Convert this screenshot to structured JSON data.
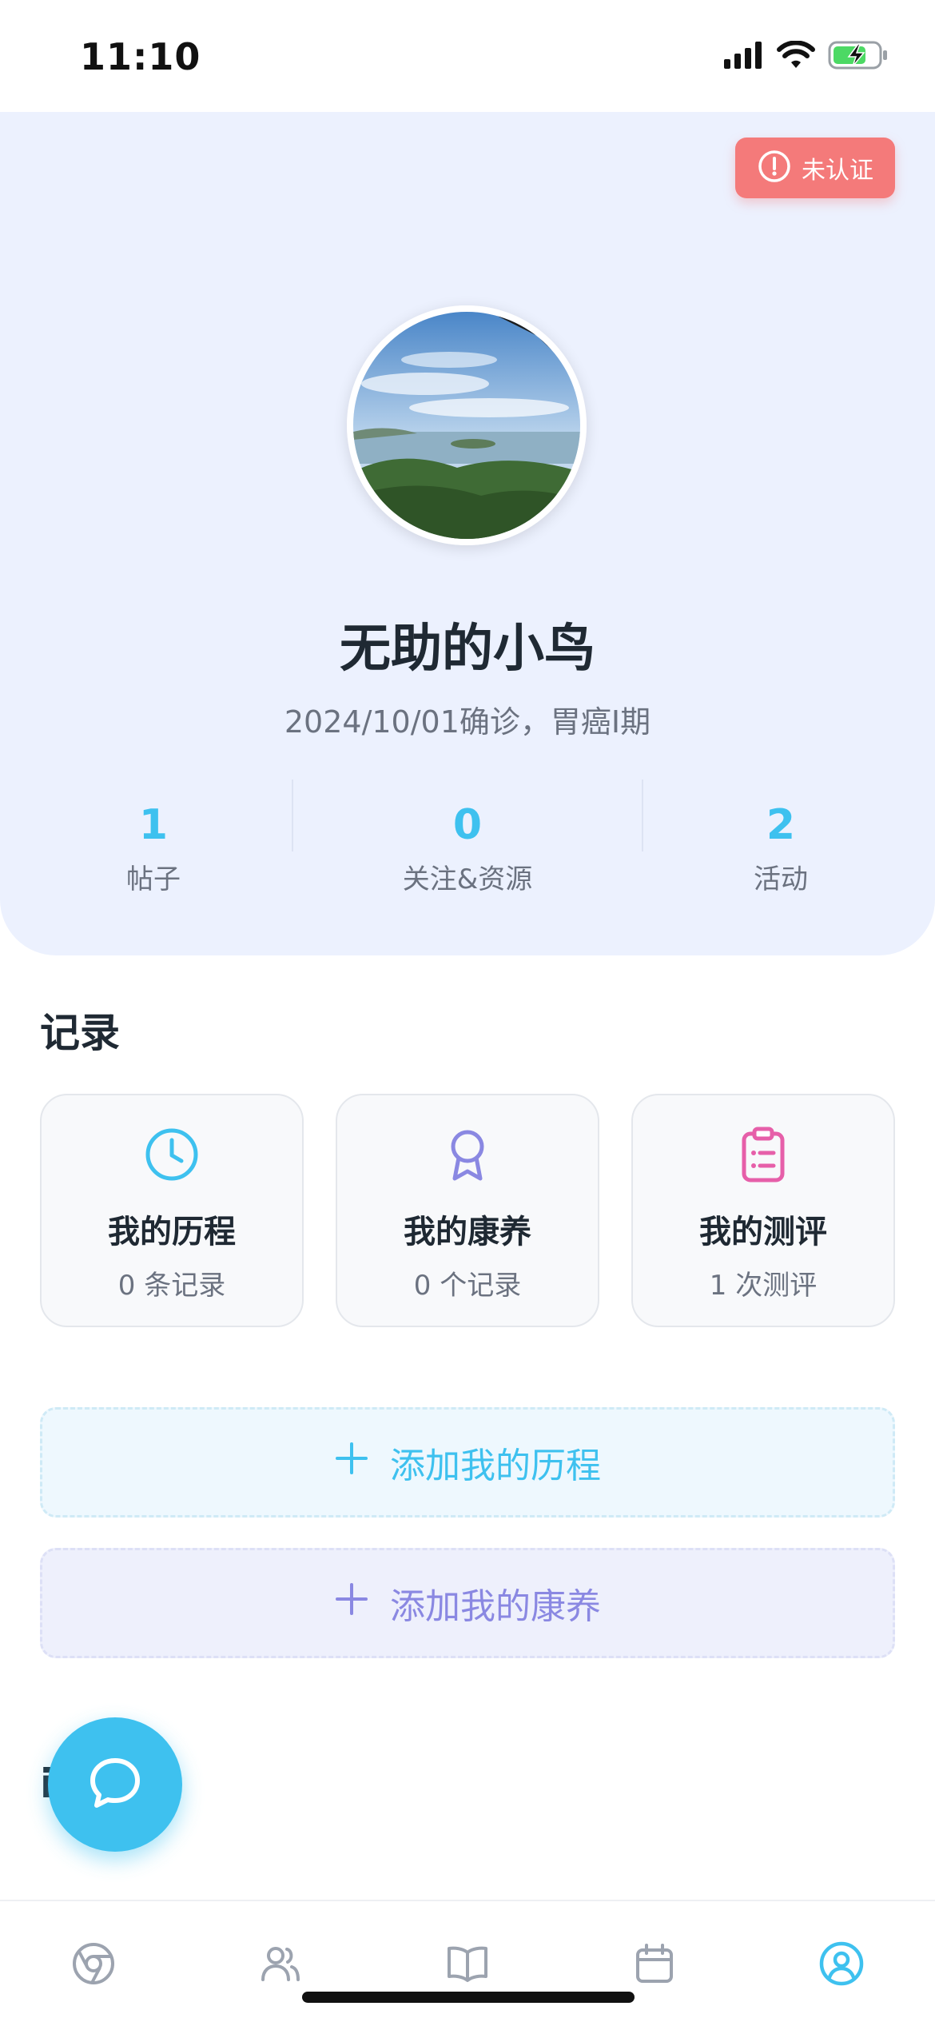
{
  "status_bar": {
    "time": "11:10",
    "icons": [
      "cellular-signal-icon",
      "wifi-icon",
      "battery-charging-icon"
    ]
  },
  "profile": {
    "certification_badge": {
      "label": "未认证",
      "icon": "alert-circle-icon",
      "color": "#f47a7a"
    },
    "avatar": {
      "alt": "avatar"
    },
    "nickname": "无助的小鸟",
    "diagnosis": "2024/10/01确诊，胃癌I期",
    "stats": [
      {
        "value": "1",
        "label": "帖子"
      },
      {
        "value": "0",
        "label": "关注&资源"
      },
      {
        "value": "2",
        "label": "活动"
      }
    ]
  },
  "records": {
    "title": "记录",
    "cards": [
      {
        "title": "我的历程",
        "subtitle": "0 条记录",
        "icon": "clock-icon",
        "color": "#3ec1ef"
      },
      {
        "title": "我的康养",
        "subtitle": "0 个记录",
        "icon": "award-ribbon-icon",
        "color": "#8a88e2"
      },
      {
        "title": "我的测评",
        "subtitle": "1 次测评",
        "icon": "clipboard-list-icon",
        "color": "#e65fa9"
      }
    ],
    "add_journey": {
      "label": "添加我的历程",
      "icon": "plus-icon"
    },
    "add_care": {
      "label": "添加我的康养",
      "icon": "plus-icon"
    }
  },
  "next_section_partial_title": "i",
  "fab": {
    "icon": "chat-bubble-icon"
  },
  "tab_bar": {
    "items": [
      {
        "icon": "chrome-browser-icon",
        "active": false
      },
      {
        "icon": "users-icon",
        "active": false
      },
      {
        "icon": "book-open-icon",
        "active": false
      },
      {
        "icon": "calendar-icon",
        "active": false
      },
      {
        "icon": "user-circle-icon",
        "active": true
      }
    ]
  },
  "colors": {
    "accent": "#3ec1ef",
    "purple": "#8a88e2",
    "pink": "#e65fa9",
    "header_bg": "#ecf1fe"
  }
}
